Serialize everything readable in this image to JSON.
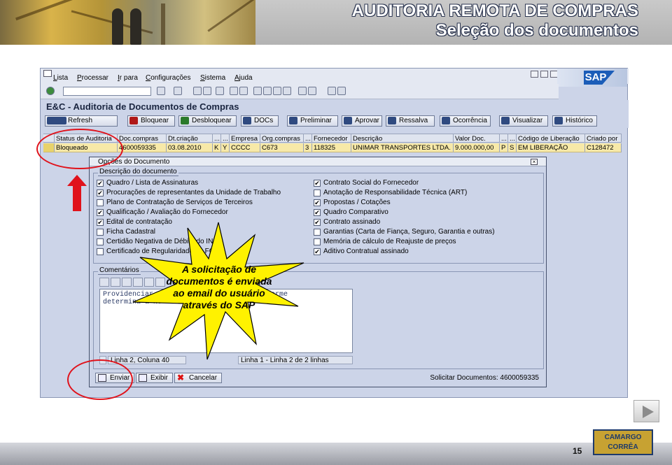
{
  "header": {
    "title_line1": "AUDITORIA REMOTA DE COMPRAS",
    "title_line2": "Seleção dos documentos"
  },
  "sap": {
    "menu": [
      "Lista",
      "Processar",
      "Ir para",
      "Configurações",
      "Sistema",
      "Ajuda"
    ],
    "logo_text": "SAP",
    "screen_title": "E&C - Auditoria de Documentos de Compras",
    "app_buttons": [
      "Refresh",
      "Bloquear",
      "Desbloquear",
      "DOCs",
      "Preliminar",
      "Aprovar",
      "Ressalva",
      "Ocorrência",
      "Visualizar",
      "Histórico"
    ],
    "grid": {
      "headers": [
        "Status de Auditoria",
        "Doc.compras",
        "Dt.criação",
        "...",
        "...",
        "Empresa",
        "Org.compras",
        "...",
        "Fornecedor",
        "Descrição",
        "Valor Doc.",
        "...",
        "...",
        "Código de Liberação",
        "Criado por"
      ],
      "row": [
        "Bloqueado",
        "4600059335",
        "03.08.2010",
        "K",
        "Y",
        "CCCC",
        "C673",
        "3",
        "118325",
        "UNIMAR TRANSPORTES LTDA.",
        "9.000.000,00",
        "P",
        "S",
        "EM LIBERAÇÃO",
        "C128472"
      ]
    },
    "dialog": {
      "title": "Opções do Documento",
      "close": "×",
      "group_label": "Descrição do documento",
      "left_checks": [
        {
          "label": "Quadro / Lista de Assinaturas",
          "checked": true
        },
        {
          "label": "Procurações de representantes da Unidade de Trabalho",
          "checked": true
        },
        {
          "label": "Plano de Contratação de Serviços de Terceiros",
          "checked": false
        },
        {
          "label": "Qualificação / Avaliação do Fornecedor",
          "checked": true
        },
        {
          "label": "Edital de contratação",
          "checked": true
        },
        {
          "label": "Ficha Cadastral",
          "checked": false
        },
        {
          "label": "Certidão Negativa de Débito do INSS",
          "checked": false
        },
        {
          "label": "Certificado de Regularidade do FGTS",
          "checked": false
        }
      ],
      "right_checks": [
        {
          "label": "Contrato Social do Fornecedor",
          "checked": true
        },
        {
          "label": "Anotação de Responsabilidade Técnica (ART)",
          "checked": false
        },
        {
          "label": "Propostas / Cotações",
          "checked": true
        },
        {
          "label": "Quadro Comparativo",
          "checked": true
        },
        {
          "label": "Contrato assinado",
          "checked": true
        },
        {
          "label": "Garantias (Carta de Fiança, Seguro, Garantia e outras)",
          "checked": false
        },
        {
          "label": "Memória de cálculo de Reajuste de preços",
          "checked": false
        },
        {
          "label": "Aditivo Contratual assinado",
          "checked": true
        }
      ],
      "comments_label": "Comentários",
      "comment_text": "Providenciar                        conforme\ndetermina a No",
      "status_left": "Linha 2, Coluna 40",
      "status_right": "Linha 1 - Linha 2 de 2 linhas",
      "buttons": [
        "Enviar",
        "Exibir",
        "Cancelar"
      ],
      "request_info": "Solicitar Documentos: 4600059335"
    }
  },
  "callout": {
    "text": "A solicitação de documentos é enviada ao email do usuário através do SAP"
  },
  "footer": {
    "page_number": "15",
    "logo_line1": "CAMARGO",
    "logo_line2": "CORRÊA"
  },
  "colors": {
    "annotation_red": "#e0121b",
    "highlight_yellow": "#f7e9a8",
    "burst_yellow": "#fff200"
  }
}
